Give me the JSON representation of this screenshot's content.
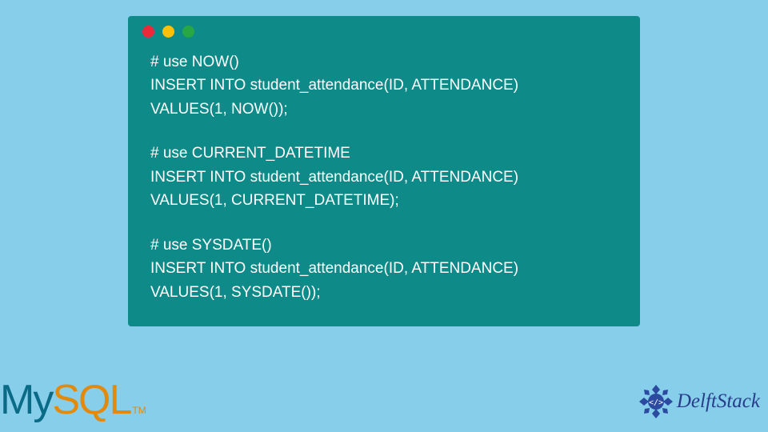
{
  "code": {
    "blocks": [
      {
        "lines": [
          "# use NOW()",
          "INSERT INTO student_attendance(ID, ATTENDANCE)",
          "VALUES(1, NOW());"
        ]
      },
      {
        "lines": [
          "# use CURRENT_DATETIME",
          "INSERT INTO student_attendance(ID, ATTENDANCE)",
          "VALUES(1, CURRENT_DATETIME);"
        ]
      },
      {
        "lines": [
          "# use SYSDATE()",
          "INSERT INTO student_attendance(ID, ATTENDANCE)",
          "VALUES(1, SYSDATE());"
        ]
      }
    ]
  },
  "logos": {
    "mysql_my": "My",
    "mysql_sql": "SQL",
    "mysql_tm": "TM",
    "delft": "DelftStack"
  },
  "colors": {
    "background": "#87ceeb",
    "window": "#0e8a89",
    "code_text": "#ffffff",
    "mysql_my": "#0a6b87",
    "mysql_sql": "#e28a0e",
    "delft": "#263d8a"
  }
}
